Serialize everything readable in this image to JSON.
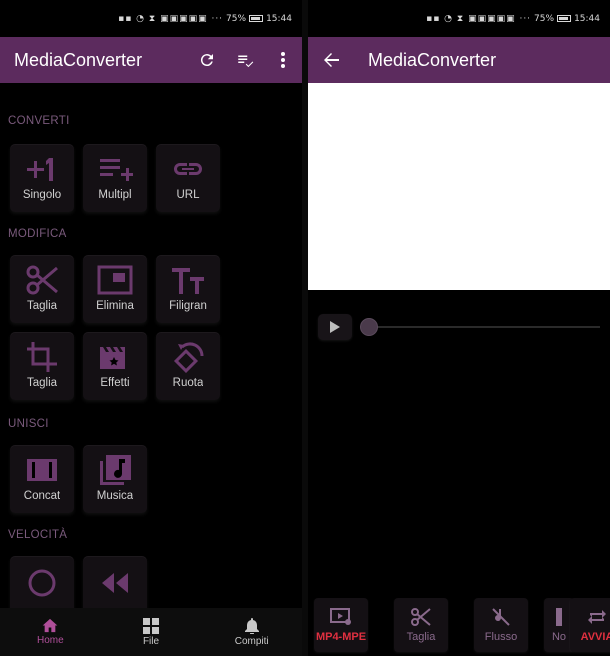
{
  "status_bar": {
    "signal": "▪▪ ◔ ⧗ ▣▣▣▣▣ ···",
    "battery_percent": "75%",
    "time": "15:44"
  },
  "left": {
    "app_title": "MediaConverter",
    "sections": [
      {
        "title": "CONVERTI",
        "items": [
          {
            "label": "Singolo",
            "icon": "plus-one-icon"
          },
          {
            "label": "Multipl",
            "icon": "playlist-add-icon"
          },
          {
            "label": "URL",
            "icon": "link-icon"
          }
        ]
      },
      {
        "title": "MODIFICA",
        "items": [
          {
            "label": "Taglia",
            "icon": "scissors-icon"
          },
          {
            "label": "Elimina",
            "icon": "picture-in-picture-icon"
          },
          {
            "label": "Filigran",
            "icon": "text-format-icon"
          },
          {
            "label": "Taglia",
            "icon": "crop-icon"
          },
          {
            "label": "Effetti",
            "icon": "movie-filter-icon"
          },
          {
            "label": "Ruota",
            "icon": "rotate-icon"
          }
        ]
      },
      {
        "title": "UNISCI",
        "items": [
          {
            "label": "Concat",
            "icon": "film-strip-icon"
          },
          {
            "label": "Musica",
            "icon": "music-library-icon"
          }
        ]
      },
      {
        "title": "VELOCITÀ",
        "items": []
      }
    ],
    "nav": [
      {
        "label": "Home",
        "icon": "home-icon"
      },
      {
        "label": "File",
        "icon": "grid-icon"
      },
      {
        "label": "Compiti",
        "icon": "bell-icon"
      }
    ]
  },
  "right": {
    "app_title": "MediaConverter",
    "player": {
      "position_fraction": 0.0
    },
    "tools": [
      {
        "label": "MP4-MPE",
        "icon": "video-settings-icon"
      },
      {
        "label": "Taglia",
        "icon": "scissors-icon"
      },
      {
        "label": "Flusso",
        "icon": "no-audio-icon"
      },
      {
        "label": "No",
        "icon": "bar-icon"
      },
      {
        "label": "AVVIA",
        "icon": "repeat-icon"
      }
    ]
  },
  "colors": {
    "appbar": "#5c2b5e",
    "accent": "#6b3a6d",
    "nav_active": "#b04f9a",
    "action_red": "#e03040"
  }
}
